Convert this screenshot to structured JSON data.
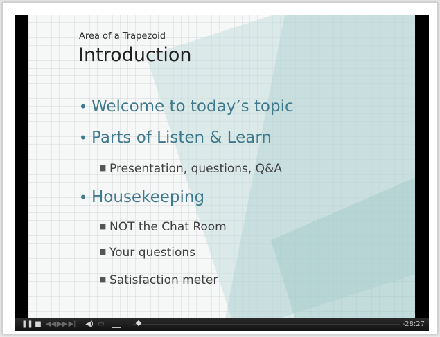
{
  "slide": {
    "subtitle": "Area of a Trapezoid",
    "title": "Introduction",
    "bullets": [
      {
        "level": 1,
        "text": "Welcome to today’s topic"
      },
      {
        "level": 1,
        "text": "Parts of Listen & Learn"
      },
      {
        "level": 2,
        "text": "Presentation, questions, Q&A"
      },
      {
        "level": 1,
        "text": "Housekeeping"
      },
      {
        "level": 2,
        "text": "NOT the Chat Room"
      },
      {
        "level": 2,
        "text": "Your questions"
      },
      {
        "level": 2,
        "text": "Satisfaction meter"
      }
    ]
  },
  "player": {
    "time_remaining": "-28:27",
    "icons": {
      "pause": "pause-icon",
      "stop": "stop-icon",
      "prev": "previous-icon",
      "next": "next-icon",
      "fast_forward": "fast-forward-icon",
      "volume": "volume-icon",
      "captions": "captions-icon",
      "fullscreen": "fullscreen-icon"
    }
  },
  "colors": {
    "bullet_level1": "#3f7a8c",
    "bullet_level2": "#404040",
    "player_bar": "#1a1a1a"
  }
}
